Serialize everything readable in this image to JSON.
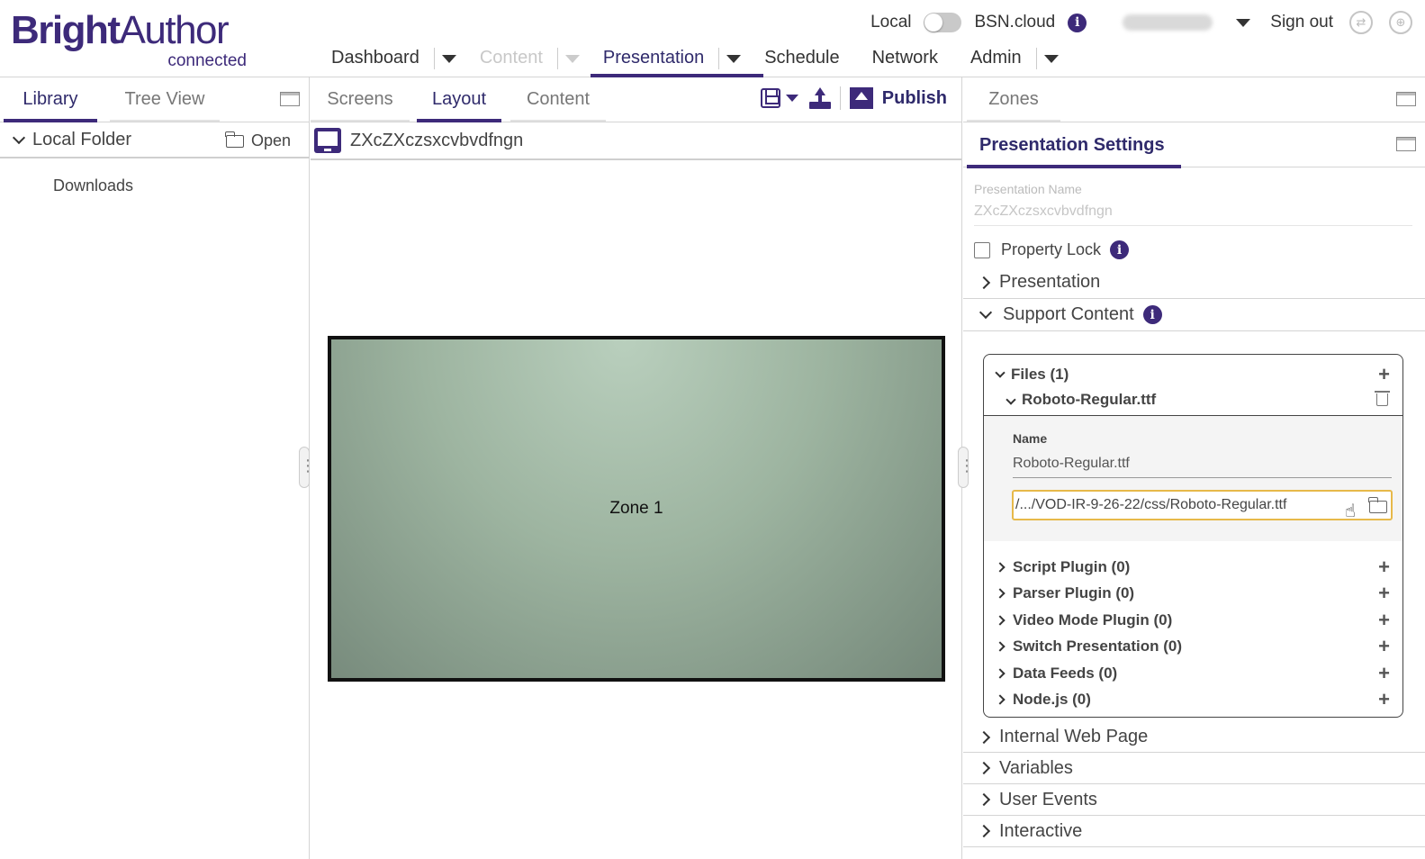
{
  "logo": {
    "bold": "Bright",
    "light": "Author",
    "sub": "connected"
  },
  "topbar": {
    "local": "Local",
    "cloud": "BSN.cloud",
    "sign_out": "Sign out"
  },
  "nav": {
    "dashboard": "Dashboard",
    "content": "Content",
    "presentation": "Presentation",
    "schedule": "Schedule",
    "network": "Network",
    "admin": "Admin"
  },
  "left": {
    "tabs": {
      "library": "Library",
      "tree_view": "Tree View"
    },
    "folder": "Local Folder",
    "open": "Open",
    "items": [
      "Downloads"
    ]
  },
  "center": {
    "tabs": {
      "screens": "Screens",
      "layout": "Layout",
      "content": "Content"
    },
    "publish": "Publish",
    "presentation_name": "ZXcZXczsxcvbvdfngn",
    "zone_label": "Zone 1"
  },
  "right": {
    "zones_tab": "Zones",
    "settings_tab": "Presentation Settings",
    "name_label": "Presentation Name",
    "name_value": "ZXcZXczsxcvbvdfngn",
    "property_lock": "Property Lock",
    "sections": {
      "presentation": "Presentation",
      "support": "Support Content",
      "internal_web": "Internal Web Page",
      "variables": "Variables",
      "user_events": "User Events",
      "interactive": "Interactive"
    },
    "files": {
      "header": "Files (1)",
      "file_name": "Roboto-Regular.ttf",
      "name_label": "Name",
      "name_value": "Roboto-Regular.ttf",
      "path_value": "/.../VOD-IR-9-26-22/css/Roboto-Regular.ttf"
    },
    "plugins": [
      "Script Plugin (0)",
      "Parser Plugin (0)",
      "Video Mode Plugin (0)",
      "Switch Presentation (0)",
      "Data Feeds (0)",
      "Node.js (0)"
    ]
  }
}
